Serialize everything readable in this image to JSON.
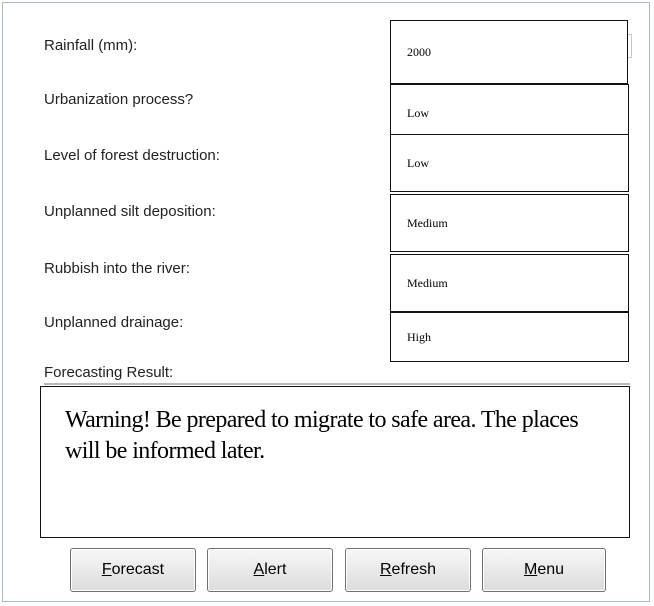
{
  "form": {
    "fields": [
      {
        "label": "Rainfall (mm):",
        "value": "2000"
      },
      {
        "label": "Urbanization process?",
        "value": "Low"
      },
      {
        "label": "Level of forest destruction:",
        "value": "Low"
      },
      {
        "label": "Unplanned silt deposition:",
        "value": "Medium"
      },
      {
        "label": "Rubbish into the river:",
        "value": "Medium"
      },
      {
        "label": "Unplanned drainage:",
        "value": "High"
      }
    ],
    "result_label": "Forecasting Result:",
    "result_text": "Warning! Be prepared to migrate to safe area. The places will be informed later."
  },
  "buttons": {
    "forecast": {
      "mnemonic": "F",
      "rest": "orecast"
    },
    "alert": {
      "mnemonic": "A",
      "rest": "lert"
    },
    "refresh": {
      "mnemonic": "R",
      "rest": "efresh"
    },
    "menu": {
      "mnemonic": "M",
      "rest": "enu"
    }
  }
}
